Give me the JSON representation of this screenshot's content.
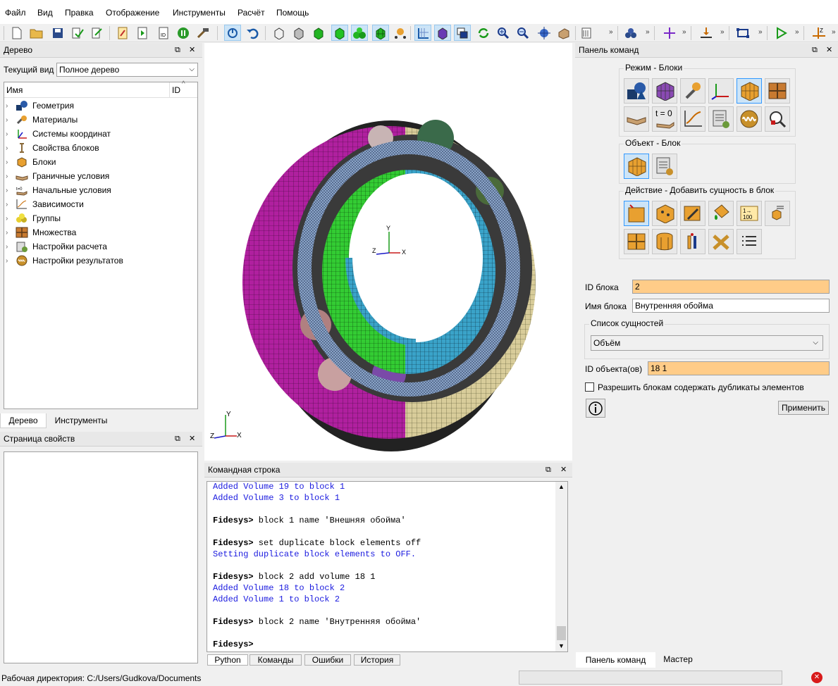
{
  "menu": [
    "Файл",
    "Вид",
    "Правка",
    "Отображение",
    "Инструменты",
    "Расчёт",
    "Помощь"
  ],
  "toolbar_overflow": "»",
  "tree_panel": {
    "title": "Дерево",
    "view_label": "Текущий вид",
    "view_value": "Полное дерево",
    "col_name": "Имя",
    "col_id": "ID",
    "items": [
      "Геометрия",
      "Материалы",
      "Системы координат",
      "Свойства блоков",
      "Блоки",
      "Граничные условия",
      "Начальные условия",
      "Зависимости",
      "Группы",
      "Множества",
      "Настройки расчета",
      "Настройки результатов"
    ],
    "tabs": [
      "Дерево",
      "Инструменты"
    ]
  },
  "props_panel": {
    "title": "Страница свойств"
  },
  "viewport": {
    "axis_y": "Y",
    "axis_x": "X",
    "axis_z": "Z"
  },
  "cmd_panel": {
    "title": "Командная строка",
    "lines": [
      {
        "t": "Added Volume 19 to block 1",
        "c": "out"
      },
      {
        "t": "Added Volume 3 to block 1",
        "c": "out"
      },
      {
        "t": "",
        "c": "in"
      },
      {
        "t": "Fidesys> block 1 name 'Внешняя обойма'",
        "c": "in"
      },
      {
        "t": "",
        "c": "in"
      },
      {
        "t": "Fidesys> set duplicate block elements off",
        "c": "in"
      },
      {
        "t": "Setting duplicate block elements to OFF.",
        "c": "out"
      },
      {
        "t": "",
        "c": "in"
      },
      {
        "t": "Fidesys> block 2 add volume 18 1",
        "c": "in"
      },
      {
        "t": "Added Volume 18 to block 2",
        "c": "out"
      },
      {
        "t": "Added Volume 1 to block 2",
        "c": "out"
      },
      {
        "t": "",
        "c": "in"
      },
      {
        "t": "Fidesys> block 2 name 'Внутренняя обойма'",
        "c": "in"
      },
      {
        "t": "",
        "c": "in"
      },
      {
        "t": "Fidesys> ",
        "c": "in"
      }
    ],
    "tabs": [
      "Python",
      "Команды",
      "Ошибки",
      "История"
    ]
  },
  "command_panel": {
    "title": "Панель команд",
    "mode_group": "Режим - Блоки",
    "object_group": "Объект - Блок",
    "action_group": "Действие - Добавить сущность в блок",
    "t0_label": "t = 0",
    "id_label": "ID блока",
    "id_value": "2",
    "name_label": "Имя блока",
    "name_value": "Внутренняя обойма",
    "entities_group": "Список сущностей",
    "entity_value": "Объём",
    "obj_ids_label": "ID объекта(ов)",
    "obj_ids_value": "18 1",
    "dup_label": "Разрешить блокам содержать дубликаты элементов",
    "apply_label": "Применить",
    "tabs": [
      "Панель команд",
      "Мастер"
    ]
  },
  "status": {
    "workdir": "Рабочая директория: C:/Users/Gudkova/Documents"
  },
  "colors": {
    "accent": "#ffcc88",
    "select": "#cce4f7",
    "outer_ring": "#b0209f",
    "outer_ring2": "#d8cc9a",
    "inner_ring": "#3aa3c9",
    "inner_ring2": "#33cc33",
    "cage": "#7a8fb4"
  }
}
